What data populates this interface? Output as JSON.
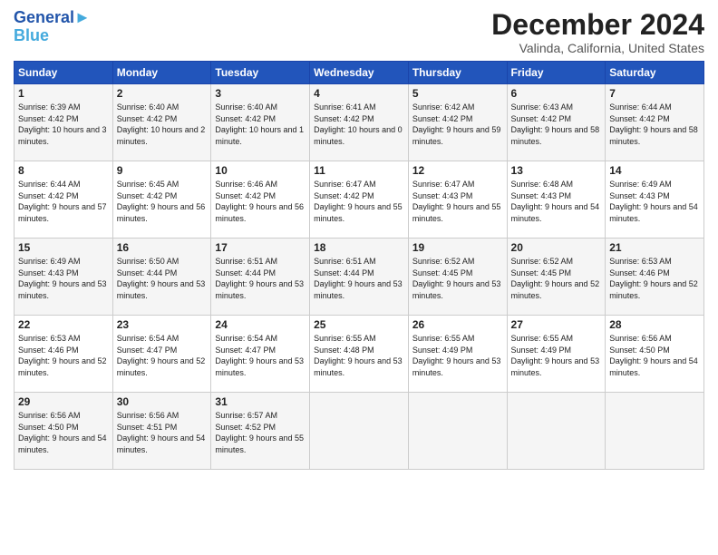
{
  "logo": {
    "line1": "General",
    "line2": "Blue"
  },
  "title": "December 2024",
  "location": "Valinda, California, United States",
  "days_of_week": [
    "Sunday",
    "Monday",
    "Tuesday",
    "Wednesday",
    "Thursday",
    "Friday",
    "Saturday"
  ],
  "weeks": [
    [
      {
        "day": "1",
        "sunrise": "Sunrise: 6:39 AM",
        "sunset": "Sunset: 4:42 PM",
        "daylight": "Daylight: 10 hours and 3 minutes."
      },
      {
        "day": "2",
        "sunrise": "Sunrise: 6:40 AM",
        "sunset": "Sunset: 4:42 PM",
        "daylight": "Daylight: 10 hours and 2 minutes."
      },
      {
        "day": "3",
        "sunrise": "Sunrise: 6:40 AM",
        "sunset": "Sunset: 4:42 PM",
        "daylight": "Daylight: 10 hours and 1 minute."
      },
      {
        "day": "4",
        "sunrise": "Sunrise: 6:41 AM",
        "sunset": "Sunset: 4:42 PM",
        "daylight": "Daylight: 10 hours and 0 minutes."
      },
      {
        "day": "5",
        "sunrise": "Sunrise: 6:42 AM",
        "sunset": "Sunset: 4:42 PM",
        "daylight": "Daylight: 9 hours and 59 minutes."
      },
      {
        "day": "6",
        "sunrise": "Sunrise: 6:43 AM",
        "sunset": "Sunset: 4:42 PM",
        "daylight": "Daylight: 9 hours and 58 minutes."
      },
      {
        "day": "7",
        "sunrise": "Sunrise: 6:44 AM",
        "sunset": "Sunset: 4:42 PM",
        "daylight": "Daylight: 9 hours and 58 minutes."
      }
    ],
    [
      {
        "day": "8",
        "sunrise": "Sunrise: 6:44 AM",
        "sunset": "Sunset: 4:42 PM",
        "daylight": "Daylight: 9 hours and 57 minutes."
      },
      {
        "day": "9",
        "sunrise": "Sunrise: 6:45 AM",
        "sunset": "Sunset: 4:42 PM",
        "daylight": "Daylight: 9 hours and 56 minutes."
      },
      {
        "day": "10",
        "sunrise": "Sunrise: 6:46 AM",
        "sunset": "Sunset: 4:42 PM",
        "daylight": "Daylight: 9 hours and 56 minutes."
      },
      {
        "day": "11",
        "sunrise": "Sunrise: 6:47 AM",
        "sunset": "Sunset: 4:42 PM",
        "daylight": "Daylight: 9 hours and 55 minutes."
      },
      {
        "day": "12",
        "sunrise": "Sunrise: 6:47 AM",
        "sunset": "Sunset: 4:43 PM",
        "daylight": "Daylight: 9 hours and 55 minutes."
      },
      {
        "day": "13",
        "sunrise": "Sunrise: 6:48 AM",
        "sunset": "Sunset: 4:43 PM",
        "daylight": "Daylight: 9 hours and 54 minutes."
      },
      {
        "day": "14",
        "sunrise": "Sunrise: 6:49 AM",
        "sunset": "Sunset: 4:43 PM",
        "daylight": "Daylight: 9 hours and 54 minutes."
      }
    ],
    [
      {
        "day": "15",
        "sunrise": "Sunrise: 6:49 AM",
        "sunset": "Sunset: 4:43 PM",
        "daylight": "Daylight: 9 hours and 53 minutes."
      },
      {
        "day": "16",
        "sunrise": "Sunrise: 6:50 AM",
        "sunset": "Sunset: 4:44 PM",
        "daylight": "Daylight: 9 hours and 53 minutes."
      },
      {
        "day": "17",
        "sunrise": "Sunrise: 6:51 AM",
        "sunset": "Sunset: 4:44 PM",
        "daylight": "Daylight: 9 hours and 53 minutes."
      },
      {
        "day": "18",
        "sunrise": "Sunrise: 6:51 AM",
        "sunset": "Sunset: 4:44 PM",
        "daylight": "Daylight: 9 hours and 53 minutes."
      },
      {
        "day": "19",
        "sunrise": "Sunrise: 6:52 AM",
        "sunset": "Sunset: 4:45 PM",
        "daylight": "Daylight: 9 hours and 53 minutes."
      },
      {
        "day": "20",
        "sunrise": "Sunrise: 6:52 AM",
        "sunset": "Sunset: 4:45 PM",
        "daylight": "Daylight: 9 hours and 52 minutes."
      },
      {
        "day": "21",
        "sunrise": "Sunrise: 6:53 AM",
        "sunset": "Sunset: 4:46 PM",
        "daylight": "Daylight: 9 hours and 52 minutes."
      }
    ],
    [
      {
        "day": "22",
        "sunrise": "Sunrise: 6:53 AM",
        "sunset": "Sunset: 4:46 PM",
        "daylight": "Daylight: 9 hours and 52 minutes."
      },
      {
        "day": "23",
        "sunrise": "Sunrise: 6:54 AM",
        "sunset": "Sunset: 4:47 PM",
        "daylight": "Daylight: 9 hours and 52 minutes."
      },
      {
        "day": "24",
        "sunrise": "Sunrise: 6:54 AM",
        "sunset": "Sunset: 4:47 PM",
        "daylight": "Daylight: 9 hours and 53 minutes."
      },
      {
        "day": "25",
        "sunrise": "Sunrise: 6:55 AM",
        "sunset": "Sunset: 4:48 PM",
        "daylight": "Daylight: 9 hours and 53 minutes."
      },
      {
        "day": "26",
        "sunrise": "Sunrise: 6:55 AM",
        "sunset": "Sunset: 4:49 PM",
        "daylight": "Daylight: 9 hours and 53 minutes."
      },
      {
        "day": "27",
        "sunrise": "Sunrise: 6:55 AM",
        "sunset": "Sunset: 4:49 PM",
        "daylight": "Daylight: 9 hours and 53 minutes."
      },
      {
        "day": "28",
        "sunrise": "Sunrise: 6:56 AM",
        "sunset": "Sunset: 4:50 PM",
        "daylight": "Daylight: 9 hours and 54 minutes."
      }
    ],
    [
      {
        "day": "29",
        "sunrise": "Sunrise: 6:56 AM",
        "sunset": "Sunset: 4:50 PM",
        "daylight": "Daylight: 9 hours and 54 minutes."
      },
      {
        "day": "30",
        "sunrise": "Sunrise: 6:56 AM",
        "sunset": "Sunset: 4:51 PM",
        "daylight": "Daylight: 9 hours and 54 minutes."
      },
      {
        "day": "31",
        "sunrise": "Sunrise: 6:57 AM",
        "sunset": "Sunset: 4:52 PM",
        "daylight": "Daylight: 9 hours and 55 minutes."
      },
      null,
      null,
      null,
      null
    ]
  ]
}
